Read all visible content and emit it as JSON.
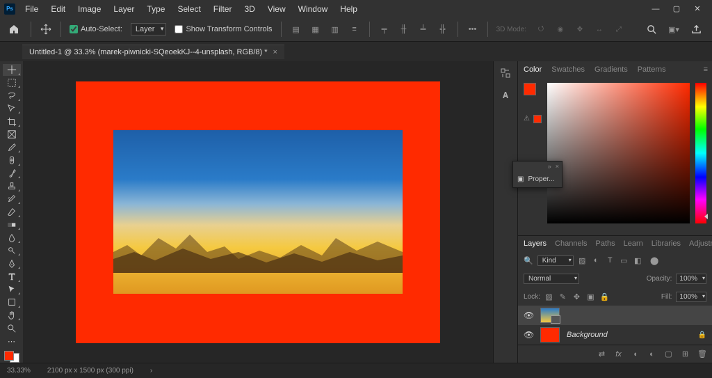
{
  "menubar": [
    "File",
    "Edit",
    "Image",
    "Layer",
    "Type",
    "Select",
    "Filter",
    "3D",
    "View",
    "Window",
    "Help"
  ],
  "optionsbar": {
    "auto_select_label": "Auto-Select:",
    "auto_select_checked": true,
    "target_dropdown": "Layer",
    "show_transform_label": "Show Transform Controls",
    "show_transform_checked": false,
    "mode_3d_label": "3D Mode:"
  },
  "document": {
    "tab_title": "Untitled-1 @ 33.3% (marek-piwnicki-SQeoekKJ--4-unsplash, RGB/8) *"
  },
  "color_panel": {
    "tabs": [
      "Color",
      "Swatches",
      "Gradients",
      "Patterns"
    ],
    "active_tab": "Color",
    "fg_color": "#ff2a00",
    "bg_color": "#ff2a00",
    "warn_color": "#ff2a00"
  },
  "floating": {
    "label": "Proper..."
  },
  "layers_panel": {
    "tabs": [
      "Layers",
      "Channels",
      "Paths",
      "Learn",
      "Libraries",
      "Adjustments"
    ],
    "active_tab": "Layers",
    "filter_kind": "Kind",
    "blend_mode": "Normal",
    "opacity_label": "Opacity:",
    "opacity_value": "100%",
    "lock_label": "Lock:",
    "fill_label": "Fill:",
    "fill_value": "100%",
    "layers": [
      {
        "name": "",
        "selected": true,
        "smart_object": true,
        "visible": true,
        "locked": false,
        "fill": "#ffffff"
      },
      {
        "name": "Background",
        "selected": false,
        "smart_object": false,
        "visible": true,
        "locked": true,
        "fill": "#ff2a00"
      }
    ]
  },
  "statusbar": {
    "zoom": "33.33%",
    "doc_info": "2100 px x 1500 px (300 ppi)"
  },
  "canvas": {
    "bg_color": "#ff2a00"
  },
  "swatch": {
    "fg": "#ff2a00",
    "bg": "#ffffff"
  }
}
